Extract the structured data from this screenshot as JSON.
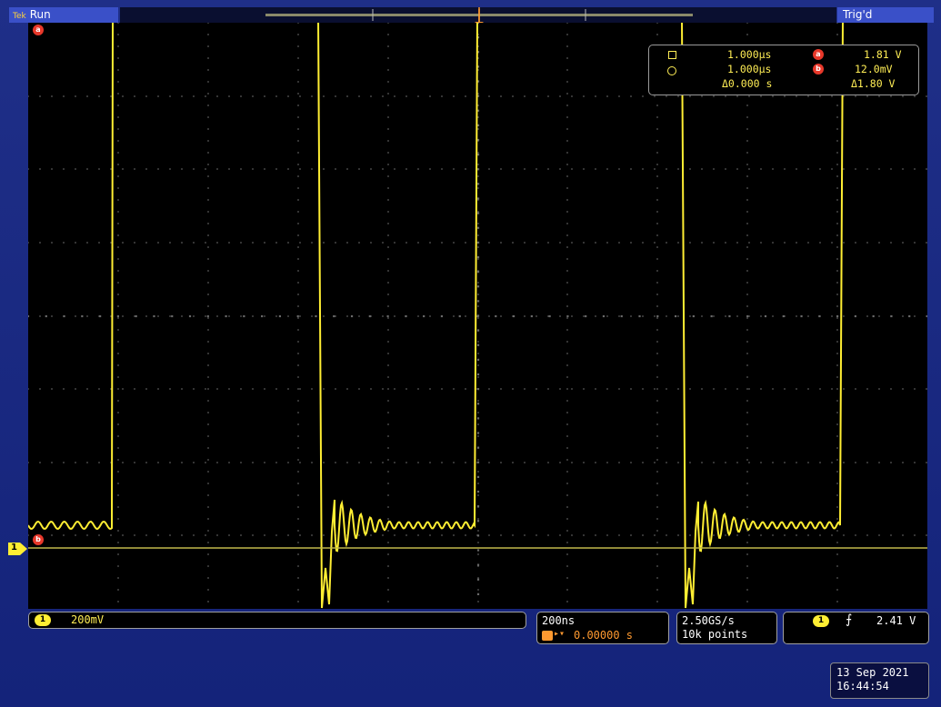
{
  "status": {
    "brand": "Tek",
    "acquisition_state": "Run",
    "trigger_state": "Trig'd"
  },
  "channel_markers": {
    "ch1_ground": "1",
    "cursor_a": "a",
    "cursor_b": "b",
    "trigger_pos": "T"
  },
  "cursors": {
    "a_time": "1.000µs",
    "b_time": "1.000µs",
    "delta_time": "Δ0.000 s",
    "a_voltage": "1.81 V",
    "b_voltage": "12.0mV",
    "delta_voltage": "Δ1.80 V",
    "a_label": "a",
    "b_label": "b"
  },
  "vertical": {
    "channel": "1",
    "scale": "200mV"
  },
  "horizontal": {
    "scale": "200ns",
    "delay_prefix": "▸▾",
    "delay": "0.00000 s"
  },
  "acquisition": {
    "sample_rate": "2.50GS/s",
    "record_length": "10k points"
  },
  "trigger": {
    "channel": "1",
    "slope": "⨍",
    "level": "2.41 V"
  },
  "datetime": {
    "date": "13 Sep  2021",
    "time": "16:44:54"
  },
  "colors": {
    "trace": "#ffee33",
    "frame": "#1f2f88",
    "grid": "#6a6a6a",
    "badge_red": "#e8382a",
    "badge_blue": "#3a50c8"
  }
}
